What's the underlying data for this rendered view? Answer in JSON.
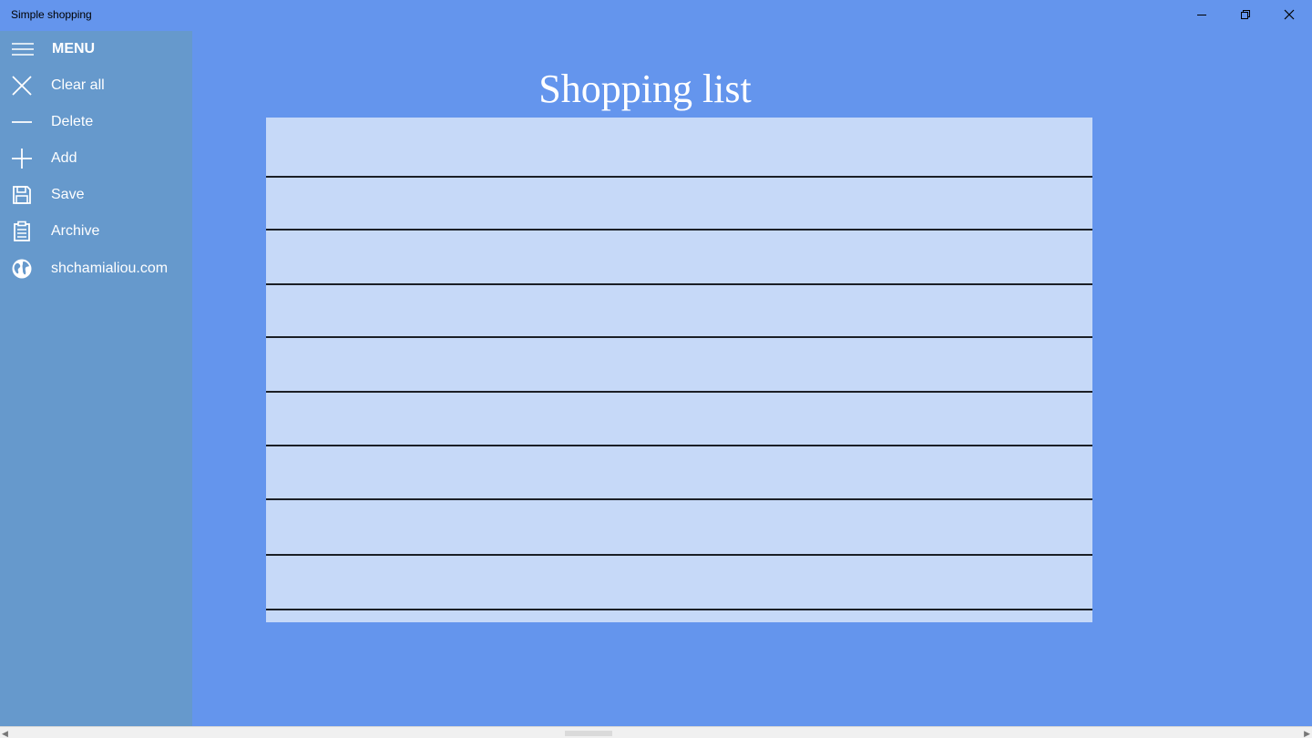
{
  "window": {
    "title": "Simple shopping",
    "controls": [
      "minimize",
      "restore",
      "close"
    ]
  },
  "sidebar": {
    "header": {
      "icon": "hamburger-icon",
      "label": "MENU"
    },
    "items": [
      {
        "icon": "close-icon",
        "label": "Clear all"
      },
      {
        "icon": "minus-icon",
        "label": "Delete"
      },
      {
        "icon": "plus-icon",
        "label": "Add"
      },
      {
        "icon": "save-icon",
        "label": "Save"
      },
      {
        "icon": "clipboard-icon",
        "label": "Archive"
      },
      {
        "icon": "globe-icon",
        "label": "shchamialiou.com"
      }
    ]
  },
  "main": {
    "title": "Shopping list",
    "rows": [
      "",
      "",
      "",
      "",
      "",
      "",
      "",
      "",
      ""
    ]
  },
  "colors": {
    "background": "#6495ed",
    "sidebar": "#6699cc",
    "list": "#c6d9f8",
    "divider": "#1b1f26",
    "text": "#ffffff"
  }
}
